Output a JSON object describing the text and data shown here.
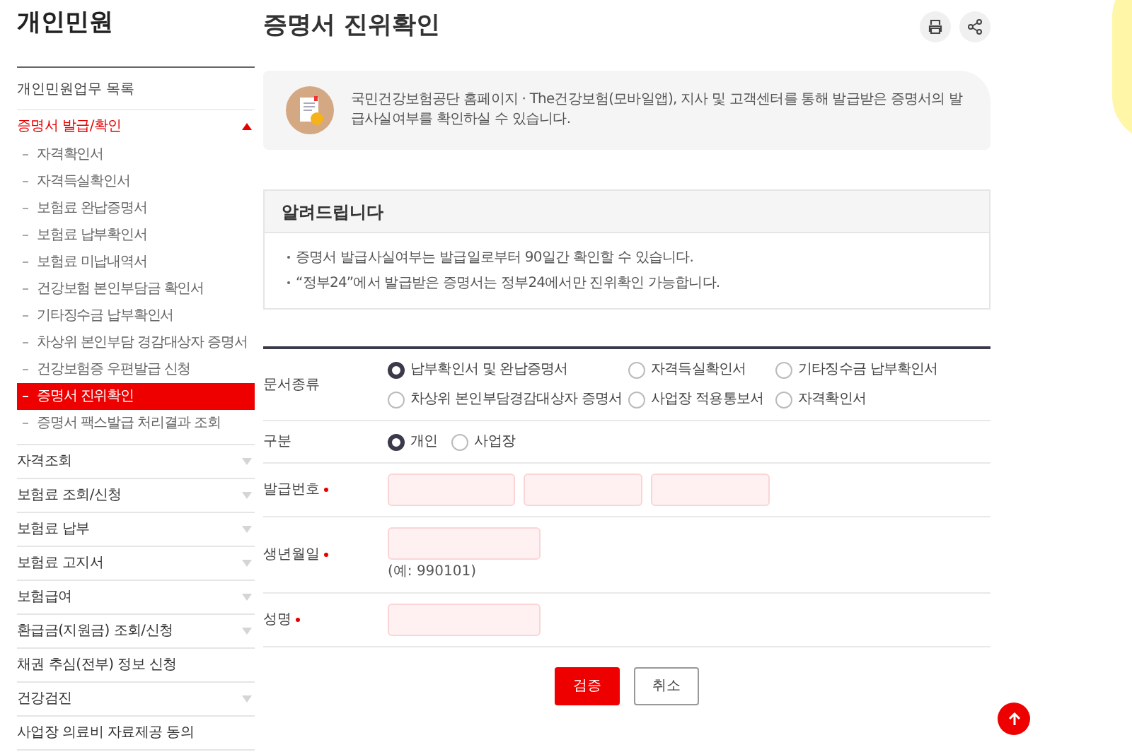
{
  "sidebar": {
    "title": "개인민원",
    "list_link": "개인민원업무 목록",
    "sections": [
      {
        "label": "증명서 발급/확인",
        "kind": "menu",
        "expanded": true,
        "children": [
          {
            "label": "자격확인서",
            "selected": false
          },
          {
            "label": "자격득실확인서",
            "selected": false
          },
          {
            "label": "보험료 완납증명서",
            "selected": false
          },
          {
            "label": "보험료 납부확인서",
            "selected": false
          },
          {
            "label": "보험료 미납내역서",
            "selected": false
          },
          {
            "label": "건강보험 본인부담금 확인서",
            "selected": false
          },
          {
            "label": "기타징수금 납부확인서",
            "selected": false
          },
          {
            "label": "차상위 본인부담 경감대상자 증명서",
            "selected": false
          },
          {
            "label": "건강보험증 우편발급 신청",
            "selected": false
          },
          {
            "label": "증명서 진위확인",
            "selected": true
          },
          {
            "label": "증명서 팩스발급 처리결과 조회",
            "selected": false
          }
        ]
      },
      {
        "label": "자격조회",
        "kind": "menu",
        "expanded": false
      },
      {
        "label": "보험료 조회/신청",
        "kind": "menu",
        "expanded": false
      },
      {
        "label": "보험료 납부",
        "kind": "menu",
        "expanded": false
      },
      {
        "label": "보험료 고지서",
        "kind": "menu",
        "expanded": false
      },
      {
        "label": "보험급여",
        "kind": "menu",
        "expanded": false
      },
      {
        "label": "환급금(지원금) 조회/신청",
        "kind": "menu",
        "expanded": false
      },
      {
        "label": "채권 추심(전부) 정보 신청",
        "kind": "link"
      },
      {
        "label": "건강검진",
        "kind": "menu",
        "expanded": false
      },
      {
        "label": "사업장 의료비 자료제공 동의",
        "kind": "link"
      }
    ]
  },
  "page": {
    "title": "증명서 진위확인"
  },
  "intro": {
    "text": "국민건강보험공단 홈페이지 · The건강보험(모바일앱), 지사 및 고객센터를 통해 발급받은 증명서의 발급사실여부를 확인하실 수 있습니다."
  },
  "notice": {
    "title": "알려드립니다",
    "items": [
      "증명서 발급사실여부는 발급일로부터 90일간 확인할 수 있습니다.",
      "“정부24”에서 발급받은 증명서는 정부24에서만 진위확인 가능합니다."
    ]
  },
  "form": {
    "rows": [
      {
        "kind": "radio",
        "label": "문서종류",
        "required": false,
        "options": [
          {
            "label": "납부확인서 및 완납증명서",
            "selected": true
          },
          {
            "label": "자격득실확인서",
            "selected": false
          },
          {
            "label": "기타징수금 납부확인서",
            "selected": false
          },
          {
            "label": "차상위 본인부담경감대상자 증명서",
            "selected": false
          },
          {
            "label": "사업장 적용통보서",
            "selected": false
          },
          {
            "label": "자격확인서",
            "selected": false
          }
        ]
      },
      {
        "kind": "radio",
        "label": "구분",
        "required": false,
        "options": [
          {
            "label": "개인",
            "selected": true
          },
          {
            "label": "사업장",
            "selected": false
          }
        ]
      },
      {
        "kind": "triple_input",
        "label": "발급번호",
        "required": true
      },
      {
        "kind": "input",
        "label": "생년월일",
        "required": true,
        "hint": "(예: 990101)"
      },
      {
        "kind": "input",
        "label": "성명",
        "required": true
      }
    ]
  },
  "buttons": [
    {
      "label": "검증",
      "kind": "primary"
    },
    {
      "label": "취소",
      "kind": "secondary"
    }
  ]
}
